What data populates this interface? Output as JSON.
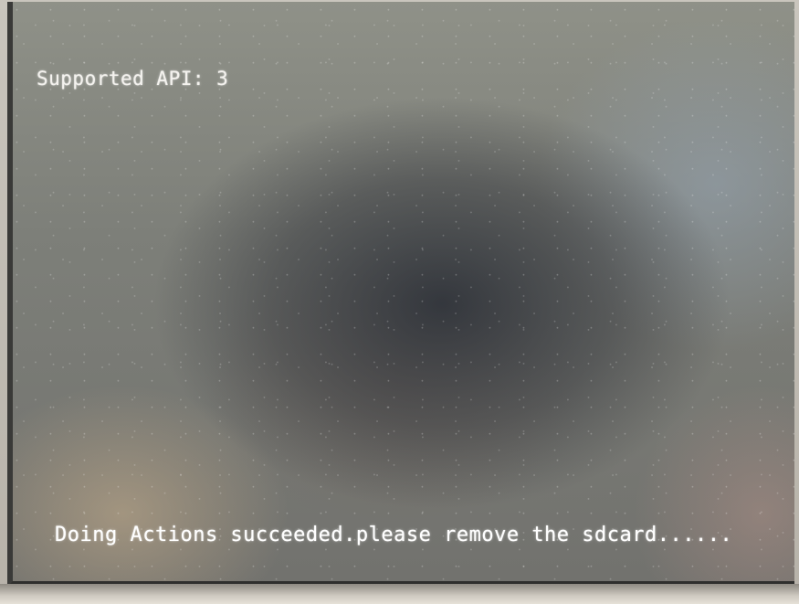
{
  "console": {
    "api_line": "Supported API: 3",
    "status_line": "Doing Actions succeeded.please remove the sdcard......"
  }
}
